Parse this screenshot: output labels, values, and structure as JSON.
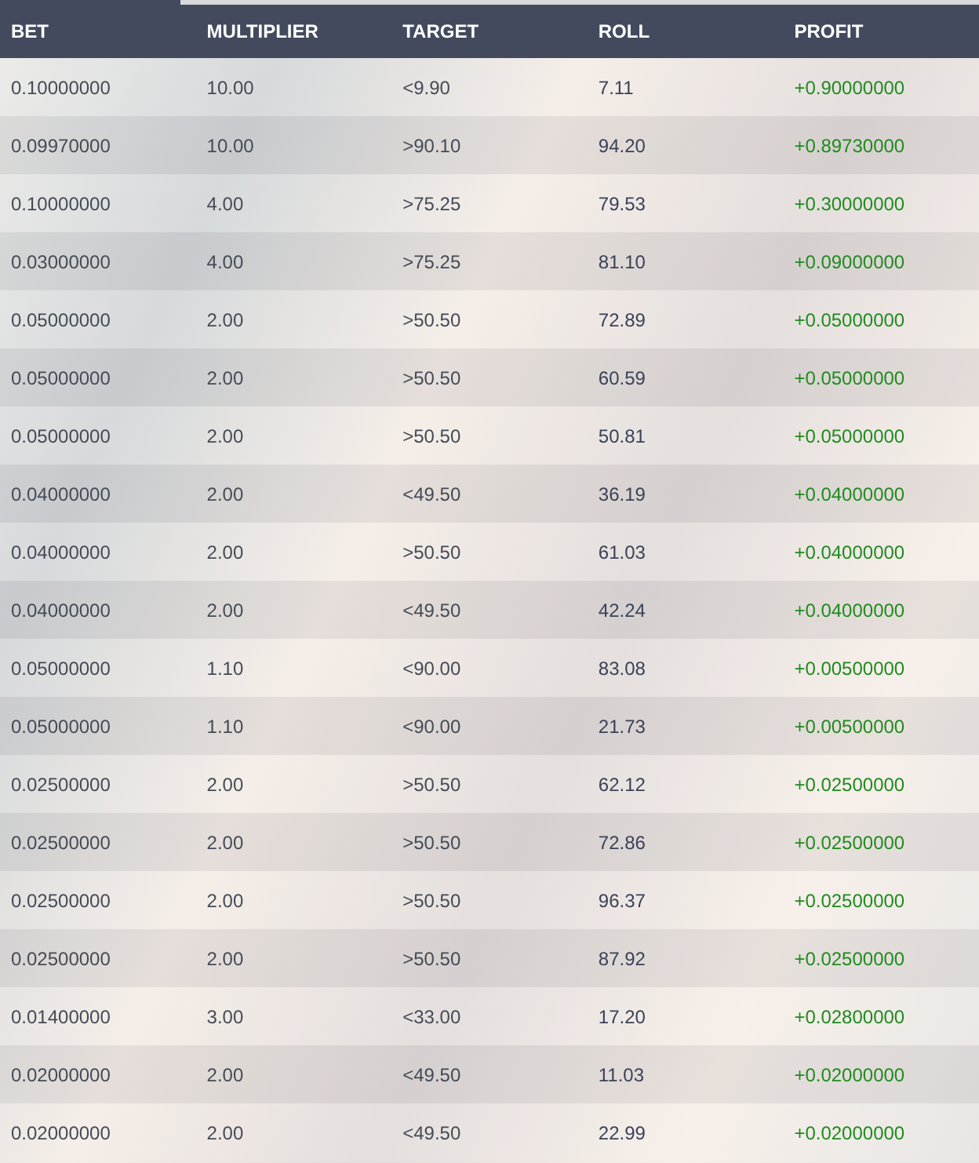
{
  "table": {
    "columns": [
      "BET",
      "MULTIPLIER",
      "TARGET",
      "ROLL",
      "PROFIT"
    ],
    "rows": [
      [
        "0.10000000",
        "10.00",
        "<9.90",
        "7.11",
        "+0.90000000"
      ],
      [
        "0.09970000",
        "10.00",
        ">90.10",
        "94.20",
        "+0.89730000"
      ],
      [
        "0.10000000",
        "4.00",
        ">75.25",
        "79.53",
        "+0.30000000"
      ],
      [
        "0.03000000",
        "4.00",
        ">75.25",
        "81.10",
        "+0.09000000"
      ],
      [
        "0.05000000",
        "2.00",
        ">50.50",
        "72.89",
        "+0.05000000"
      ],
      [
        "0.05000000",
        "2.00",
        ">50.50",
        "60.59",
        "+0.05000000"
      ],
      [
        "0.05000000",
        "2.00",
        ">50.50",
        "50.81",
        "+0.05000000"
      ],
      [
        "0.04000000",
        "2.00",
        "<49.50",
        "36.19",
        "+0.04000000"
      ],
      [
        "0.04000000",
        "2.00",
        ">50.50",
        "61.03",
        "+0.04000000"
      ],
      [
        "0.04000000",
        "2.00",
        "<49.50",
        "42.24",
        "+0.04000000"
      ],
      [
        "0.05000000",
        "1.10",
        "<90.00",
        "83.08",
        "+0.00500000"
      ],
      [
        "0.05000000",
        "1.10",
        "<90.00",
        "21.73",
        "+0.00500000"
      ],
      [
        "0.02500000",
        "2.00",
        ">50.50",
        "62.12",
        "+0.02500000"
      ],
      [
        "0.02500000",
        "2.00",
        ">50.50",
        "72.86",
        "+0.02500000"
      ],
      [
        "0.02500000",
        "2.00",
        ">50.50",
        "96.37",
        "+0.02500000"
      ],
      [
        "0.02500000",
        "2.00",
        ">50.50",
        "87.92",
        "+0.02500000"
      ],
      [
        "0.01400000",
        "3.00",
        "<33.00",
        "17.20",
        "+0.02800000"
      ],
      [
        "0.02000000",
        "2.00",
        "<49.50",
        "11.03",
        "+0.02000000"
      ],
      [
        "0.02000000",
        "2.00",
        "<49.50",
        "22.99",
        "+0.02000000"
      ]
    ]
  }
}
